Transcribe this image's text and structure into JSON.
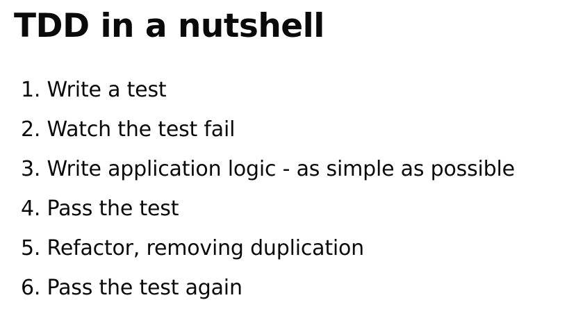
{
  "slide": {
    "title": "TDD in a nutshell",
    "steps": [
      "1. Write a test",
      "2. Watch the test fail",
      "3. Write application logic - as simple as possible",
      "4. Pass the test",
      "5. Refactor, removing duplication",
      "6. Pass the test again"
    ]
  }
}
